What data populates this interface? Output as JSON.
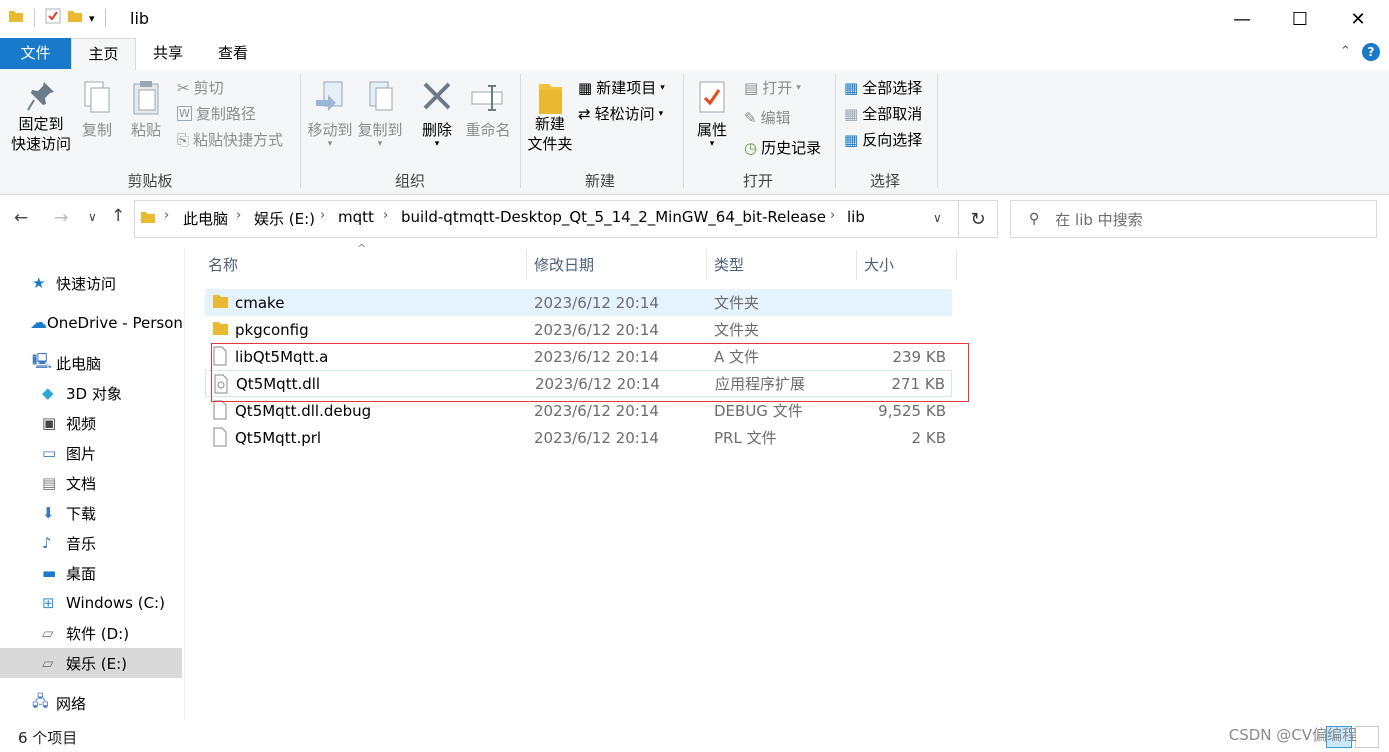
{
  "window": {
    "title": "lib",
    "minimize_glyph": "—",
    "maximize_glyph": "☐",
    "close_glyph": "✕"
  },
  "ribbon_tabs": [
    "文件",
    "主页",
    "共享",
    "查看"
  ],
  "ribbon": {
    "clipboard": {
      "pin_label_1": "固定到",
      "pin_label_2": "快速访问",
      "copy": "复制",
      "paste": "粘贴",
      "cut": "剪切",
      "copy_path": "复制路径",
      "paste_shortcut": "粘贴快捷方式",
      "group": "剪贴板"
    },
    "organize": {
      "move_to": "移动到",
      "copy_to": "复制到",
      "delete": "删除",
      "rename": "重命名",
      "group": "组织"
    },
    "new": {
      "new_folder_1": "新建",
      "new_folder_2": "文件夹",
      "new_item": "新建项目",
      "easy_access": "轻松访问",
      "group": "新建"
    },
    "open": {
      "properties": "属性",
      "open": "打开",
      "edit": "编辑",
      "history": "历史记录",
      "group": "打开"
    },
    "select": {
      "select_all": "全部选择",
      "select_none": "全部取消",
      "invert": "反向选择",
      "group": "选择"
    }
  },
  "breadcrumb": [
    "此电脑",
    "娱乐 (E:)",
    "mqtt",
    "build-qtmqtt-Desktop_Qt_5_14_2_MinGW_64_bit-Release",
    "lib"
  ],
  "search": {
    "placeholder": "在 lib 中搜索"
  },
  "nav": [
    {
      "label": "快速访问",
      "icon": "star-icon"
    },
    {
      "label": "OneDrive - Personal",
      "icon": "cloud-icon"
    },
    {
      "label": "此电脑",
      "icon": "pc-icon"
    },
    {
      "label": "3D 对象",
      "icon": "cube-icon"
    },
    {
      "label": "视频",
      "icon": "video-icon"
    },
    {
      "label": "图片",
      "icon": "picture-icon"
    },
    {
      "label": "文档",
      "icon": "document-icon"
    },
    {
      "label": "下载",
      "icon": "download-icon"
    },
    {
      "label": "音乐",
      "icon": "music-icon"
    },
    {
      "label": "桌面",
      "icon": "desktop-icon"
    },
    {
      "label": "Windows (C:)",
      "icon": "drive-icon"
    },
    {
      "label": "软件 (D:)",
      "icon": "drive-icon"
    },
    {
      "label": "娱乐 (E:)",
      "icon": "drive-icon"
    },
    {
      "label": "网络",
      "icon": "network-icon"
    }
  ],
  "columns": [
    "名称",
    "修改日期",
    "类型",
    "大小"
  ],
  "files": [
    {
      "name": "cmake",
      "date": "2023/6/12 20:14",
      "type": "文件夹",
      "size": "",
      "kind": "folder"
    },
    {
      "name": "pkgconfig",
      "date": "2023/6/12 20:14",
      "type": "文件夹",
      "size": "",
      "kind": "folder"
    },
    {
      "name": "libQt5Mqtt.a",
      "date": "2023/6/12 20:14",
      "type": "A 文件",
      "size": "239 KB",
      "kind": "file"
    },
    {
      "name": "Qt5Mqtt.dll",
      "date": "2023/6/12 20:14",
      "type": "应用程序扩展",
      "size": "271 KB",
      "kind": "dll"
    },
    {
      "name": "Qt5Mqtt.dll.debug",
      "date": "2023/6/12 20:14",
      "type": "DEBUG 文件",
      "size": "9,525 KB",
      "kind": "file"
    },
    {
      "name": "Qt5Mqtt.prl",
      "date": "2023/6/12 20:14",
      "type": "PRL 文件",
      "size": "2 KB",
      "kind": "file"
    }
  ],
  "status": {
    "count": "6 个项目"
  },
  "watermark": "CSDN @CV偏编程",
  "colors": {
    "accent": "#1979ca",
    "selection": "#e5f3ff",
    "highlight_box": "#e0383e"
  }
}
